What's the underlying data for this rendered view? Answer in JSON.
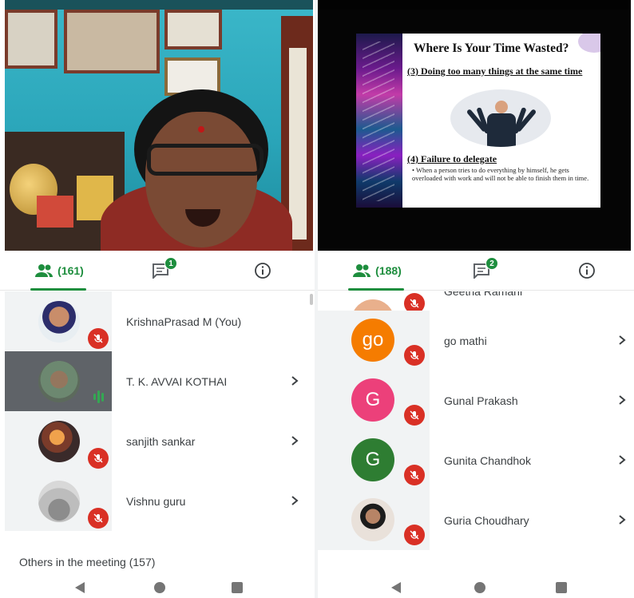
{
  "colors": {
    "accent_green": "#1e8e3e",
    "mic_off_red": "#d93025",
    "speaking_green": "#34a853",
    "text": "#3c4043"
  },
  "left_panel": {
    "tabs": {
      "people_count": "(161)",
      "chat_badge": "1",
      "people_icon": "people-icon",
      "chat_icon": "chat-icon",
      "info_icon": "info-icon"
    },
    "participants": [
      {
        "name": "KrishnaPrasad M (You)",
        "status": "mic-off"
      },
      {
        "name": "T. K. AVVAI KOTHAI",
        "status": "speaking",
        "selected": true
      },
      {
        "name": "sanjith sankar",
        "status": "mic-off"
      },
      {
        "name": "Vishnu guru",
        "status": "mic-off"
      }
    ],
    "others_label": "Others in the meeting (157)"
  },
  "right_panel": {
    "slide": {
      "title": "Where Is Your Time Wasted?",
      "point1": "(3) Doing too many things at the same time",
      "point2": "(4) Failure to delegate",
      "body": "• When a person tries to do everything by himself, he gets overloaded with work and will not be able to finish them in time."
    },
    "tabs": {
      "people_count": "(188)",
      "chat_badge": "2"
    },
    "participants": [
      {
        "name": "Geetha Ramani",
        "status": "mic-off",
        "partial": true
      },
      {
        "name": "go mathi",
        "initials": "go",
        "avatar_color": "#f57c00",
        "status": "mic-off"
      },
      {
        "name": "Gunal Prakash",
        "initials": "G",
        "avatar_color": "#ec407a",
        "status": "mic-off"
      },
      {
        "name": "Gunita Chandhok",
        "initials": "G",
        "avatar_color": "#2e7d32",
        "status": "mic-off"
      },
      {
        "name": "Guria Choudhary",
        "status": "mic-off"
      }
    ]
  }
}
